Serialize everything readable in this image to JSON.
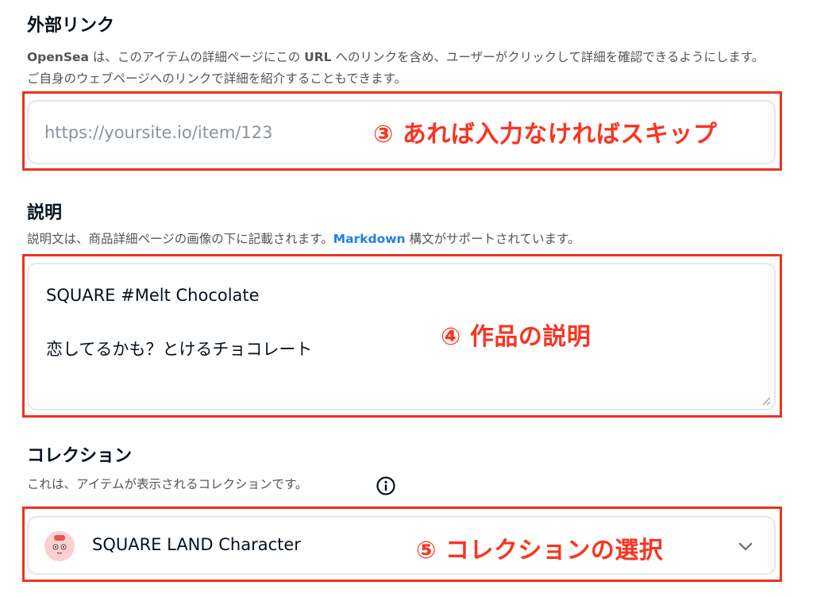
{
  "external_link": {
    "title": "外部リンク",
    "description_brand": "OpenSea",
    "description_part1": " は、このアイテムの詳細ページにこの ",
    "description_url": "URL",
    "description_part2": " へのリンクを含め、ユーザーがクリックして詳細を確認できるようにします。ご自身のウェブページへのリンクで詳細を紹介することもできます。",
    "placeholder": "https://yoursite.io/item/123",
    "value": "",
    "annotation": "③ あれば入力なければスキップ"
  },
  "description": {
    "title": "説明",
    "description_part1": "説明文は、商品詳細ページの画像の下に記載されます。",
    "description_link": "Markdown",
    "description_part2": " 構文がサポートされています。",
    "value_line1": "SQUARE #Melt Chocolate",
    "value_line2": "恋してるかも？とけるチョコレート",
    "annotation": "④ 作品の説明"
  },
  "collection": {
    "title": "コレクション",
    "description": "これは、アイテムが表示されるコレクションです。",
    "selected_value": "SQUARE LAND Character",
    "annotation": "⑤ コレクションの選択"
  },
  "icons": {
    "info": "info-icon",
    "chevron": "chevron-down-icon",
    "resize": "resize-handle-icon",
    "avatar": "collection-avatar"
  },
  "colors": {
    "annotation": "#fb3320",
    "frame": "#eb3323",
    "link": "#2081e2",
    "field_border": "#e5e8eb"
  }
}
